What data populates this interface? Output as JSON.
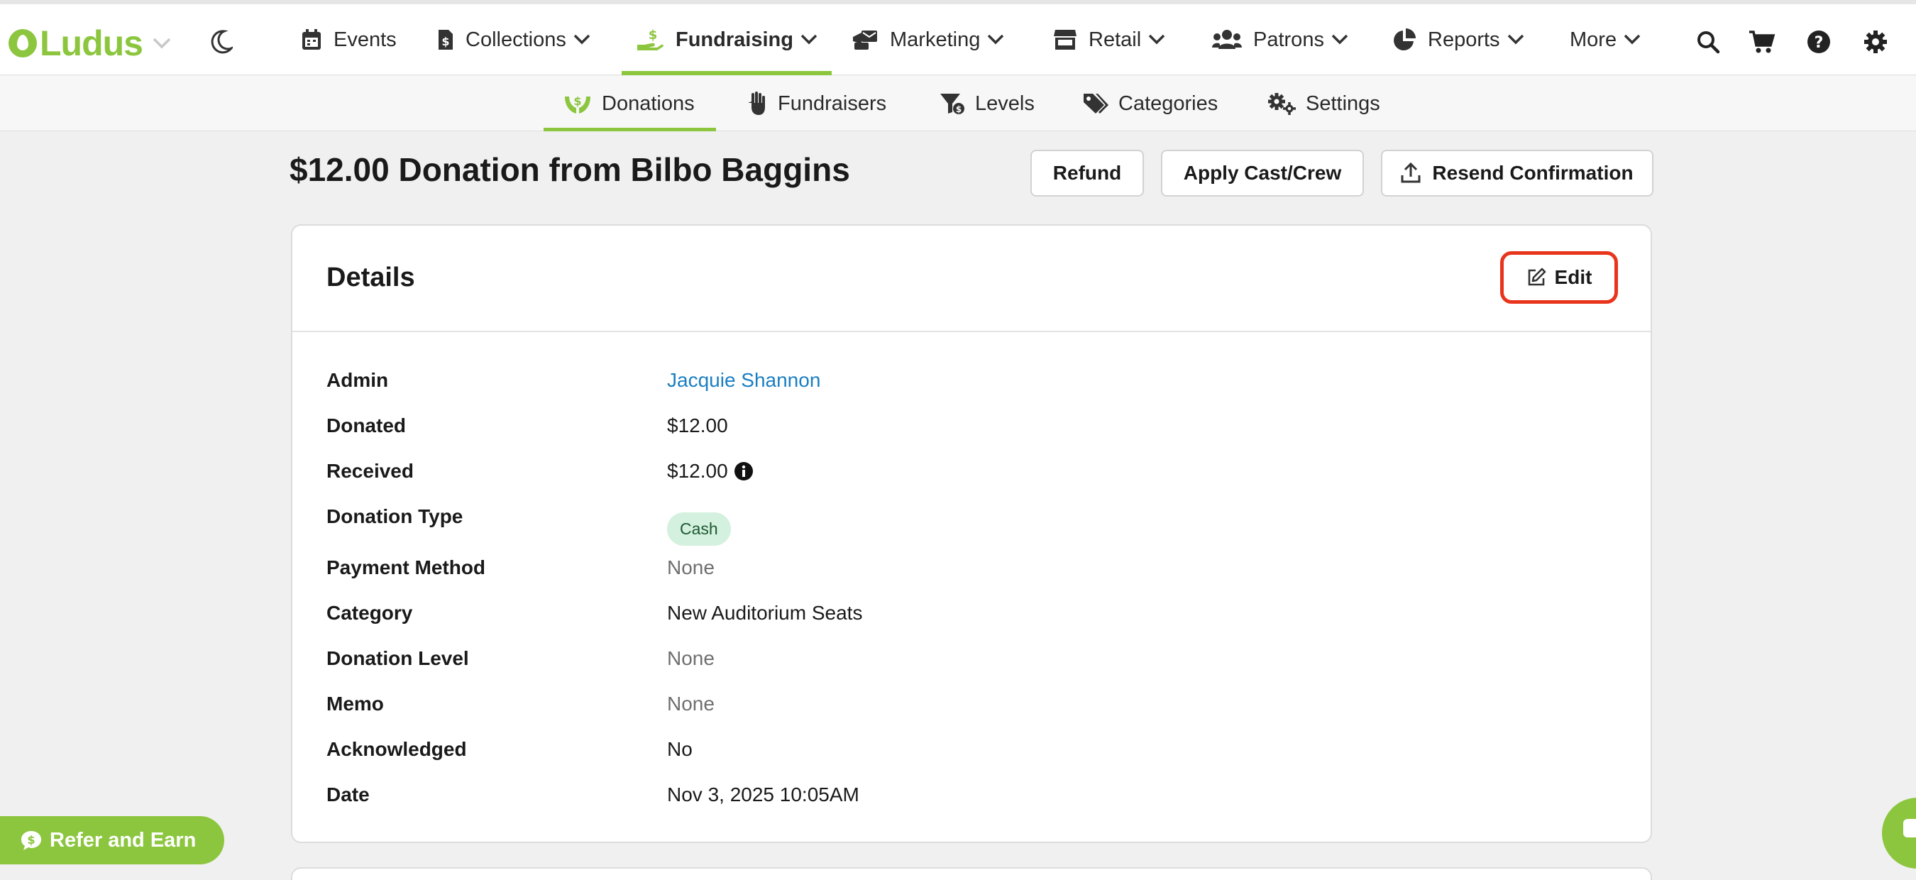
{
  "brand": {
    "name": "Ludus",
    "accent_color": "#8cc63f",
    "highlight_color": "#e8341c",
    "link_color": "#1a7fc1"
  },
  "topnav": {
    "items": [
      {
        "label": "Events",
        "icon": "calendar-icon",
        "has_dropdown": false
      },
      {
        "label": "Collections",
        "icon": "document-dollar-icon",
        "has_dropdown": true
      },
      {
        "label": "Fundraising",
        "icon": "hand-dollar-icon",
        "has_dropdown": true,
        "active": true
      },
      {
        "label": "Marketing",
        "icon": "mail-bullhorn-icon",
        "has_dropdown": true
      },
      {
        "label": "Retail",
        "icon": "store-icon",
        "has_dropdown": true
      },
      {
        "label": "Patrons",
        "icon": "users-icon",
        "has_dropdown": true
      },
      {
        "label": "Reports",
        "icon": "pie-chart-icon",
        "has_dropdown": true
      },
      {
        "label": "More",
        "has_dropdown": true
      }
    ],
    "tools": [
      "search-icon",
      "cart-icon",
      "help-icon",
      "gear-icon"
    ]
  },
  "subnav": {
    "items": [
      {
        "label": "Donations",
        "icon": "donation-hands-icon",
        "active": true
      },
      {
        "label": "Fundraisers",
        "icon": "raised-hand-icon"
      },
      {
        "label": "Levels",
        "icon": "funnel-dollar-icon"
      },
      {
        "label": "Categories",
        "icon": "tags-icon"
      },
      {
        "label": "Settings",
        "icon": "gears-icon"
      }
    ]
  },
  "page": {
    "title": "$12.00 Donation from Bilbo Baggins",
    "actions": {
      "refund": "Refund",
      "apply_cast_crew": "Apply Cast/Crew",
      "resend_confirmation": "Resend Confirmation"
    }
  },
  "details": {
    "title": "Details",
    "edit_label": "Edit",
    "rows": [
      {
        "label": "Admin",
        "value": "Jacquie Shannon"
      },
      {
        "label": "Donated",
        "value": "$12.00"
      },
      {
        "label": "Received",
        "value": "$12.00"
      },
      {
        "label": "Donation Type",
        "value": "Cash"
      },
      {
        "label": "Payment Method",
        "value": "None"
      },
      {
        "label": "Category",
        "value": "New Auditorium Seats"
      },
      {
        "label": "Donation Level",
        "value": "None"
      },
      {
        "label": "Memo",
        "value": "None"
      },
      {
        "label": "Acknowledged",
        "value": "No"
      },
      {
        "label": "Date",
        "value": "Nov 3, 2025 10:05AM"
      }
    ]
  },
  "refer": {
    "label": "Refer and Earn"
  }
}
